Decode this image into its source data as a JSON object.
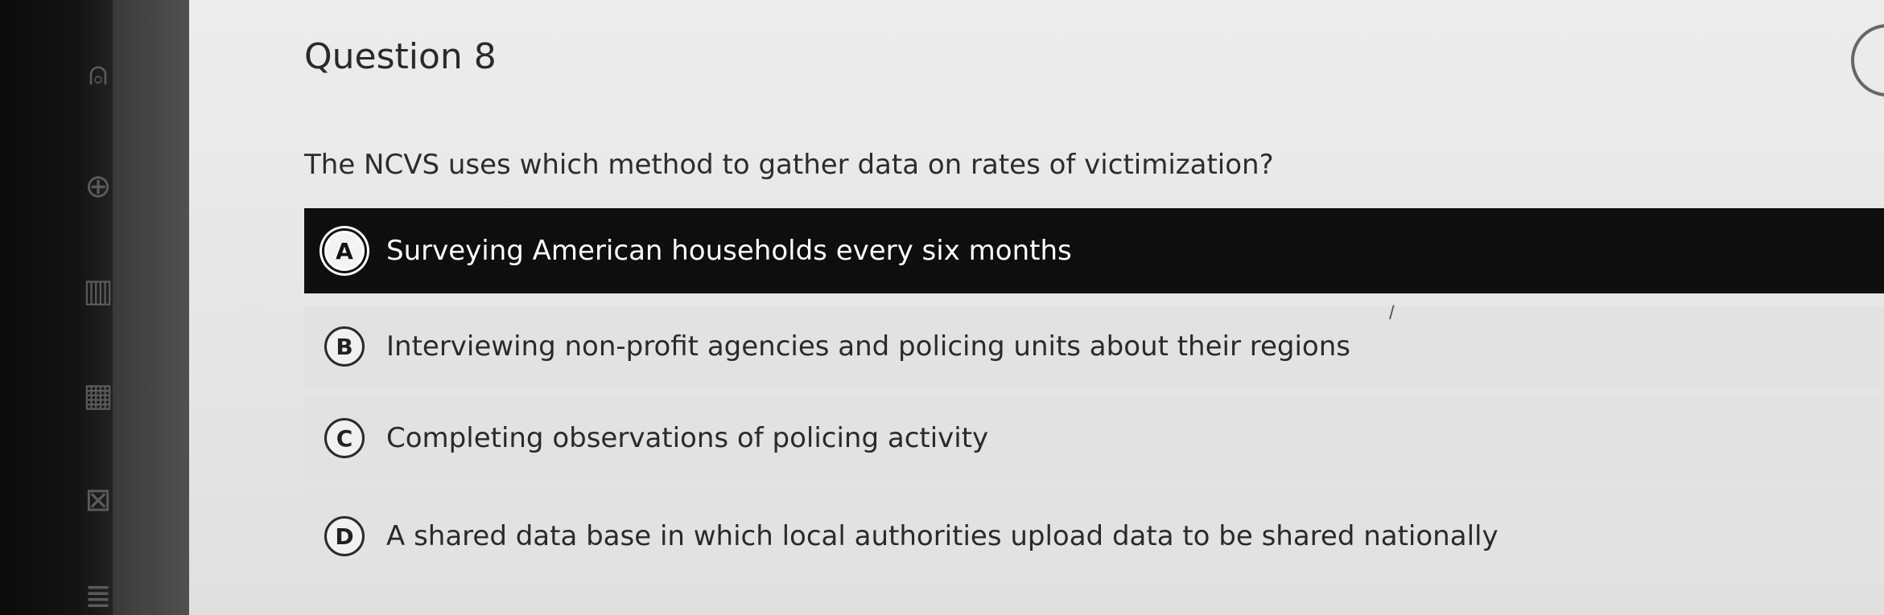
{
  "question": {
    "title": "Question 8",
    "text": "The NCVS uses which method to gather data on rates of victimization?"
  },
  "answers": [
    {
      "letter": "A",
      "label": "Surveying American households every six months",
      "selected": true
    },
    {
      "letter": "B",
      "label": "Interviewing non-profit agencies and policing units about their regions",
      "selected": false
    },
    {
      "letter": "C",
      "label": "Completing observations of policing activity",
      "selected": false
    },
    {
      "letter": "D",
      "label": "A shared data base in which local authorities upload data to be shared nationally",
      "selected": false
    }
  ],
  "sidebar": {
    "icons": [
      "user-icon",
      "globe-icon",
      "calendar-icon",
      "grid-icon",
      "mail-icon",
      "list-icon"
    ]
  },
  "colors": {
    "selected_background": "#0e0e0e",
    "selected_text": "#ffffff",
    "unselected_background": "#e2e2e2"
  }
}
